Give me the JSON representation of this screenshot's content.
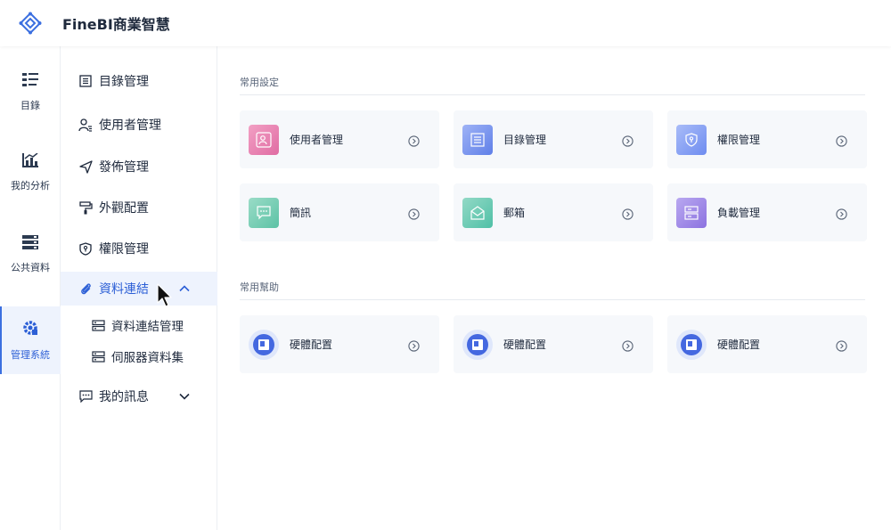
{
  "header": {
    "title": "FineBI商業智慧",
    "logo_icon": "finebi-logo-icon",
    "accent": "#3b6fe0"
  },
  "rail": {
    "items": [
      {
        "label": "目錄",
        "icon": "directory-icon"
      },
      {
        "label": "我的分析",
        "icon": "analysis-chart-icon"
      },
      {
        "label": "公共資料",
        "icon": "database-icon"
      },
      {
        "label": "管理系統",
        "icon": "gear-icon",
        "active": true
      }
    ]
  },
  "sidebar": {
    "items": [
      {
        "label": "目錄管理",
        "icon": "list-icon"
      },
      {
        "label": "使用者管理",
        "icon": "user-icon"
      },
      {
        "label": "發佈管理",
        "icon": "send-icon"
      },
      {
        "label": "外觀配置",
        "icon": "paint-roller-icon"
      },
      {
        "label": "權限管理",
        "icon": "shield-icon"
      },
      {
        "label": "資料連結",
        "icon": "paperclip-icon",
        "active": true,
        "expanded": true
      },
      {
        "label": "資料連結管理",
        "icon": "server-icon",
        "sub": true
      },
      {
        "label": "伺服器資料集",
        "icon": "server-icon",
        "sub": true
      },
      {
        "label": "我的訊息",
        "icon": "message-icon",
        "expanded": false
      }
    ]
  },
  "main": {
    "common_settings": {
      "title": "常用設定",
      "cards": [
        {
          "label": "使用者管理",
          "icon": "user-card-icon",
          "color": "#e36ea5"
        },
        {
          "label": "目錄管理",
          "icon": "list-card-icon",
          "color": "#5f7fe8"
        },
        {
          "label": "權限管理",
          "icon": "shield-card-icon",
          "color": "#6e8cf0"
        },
        {
          "label": "簡訊",
          "icon": "sms-icon",
          "color": "#5cc2a5"
        },
        {
          "label": "郵箱",
          "icon": "mail-icon",
          "color": "#4fc0a6"
        },
        {
          "label": "負載管理",
          "icon": "server-card-icon",
          "color": "#8c72e0"
        }
      ]
    },
    "common_help": {
      "title": "常用幫助",
      "cards": [
        {
          "label": "硬體配置",
          "icon": "hardware-icon",
          "color": "#4468e0"
        },
        {
          "label": "硬體配置",
          "icon": "hardware-icon",
          "color": "#4468e0"
        },
        {
          "label": "硬體配置",
          "icon": "hardware-icon",
          "color": "#4468e0"
        }
      ]
    }
  }
}
